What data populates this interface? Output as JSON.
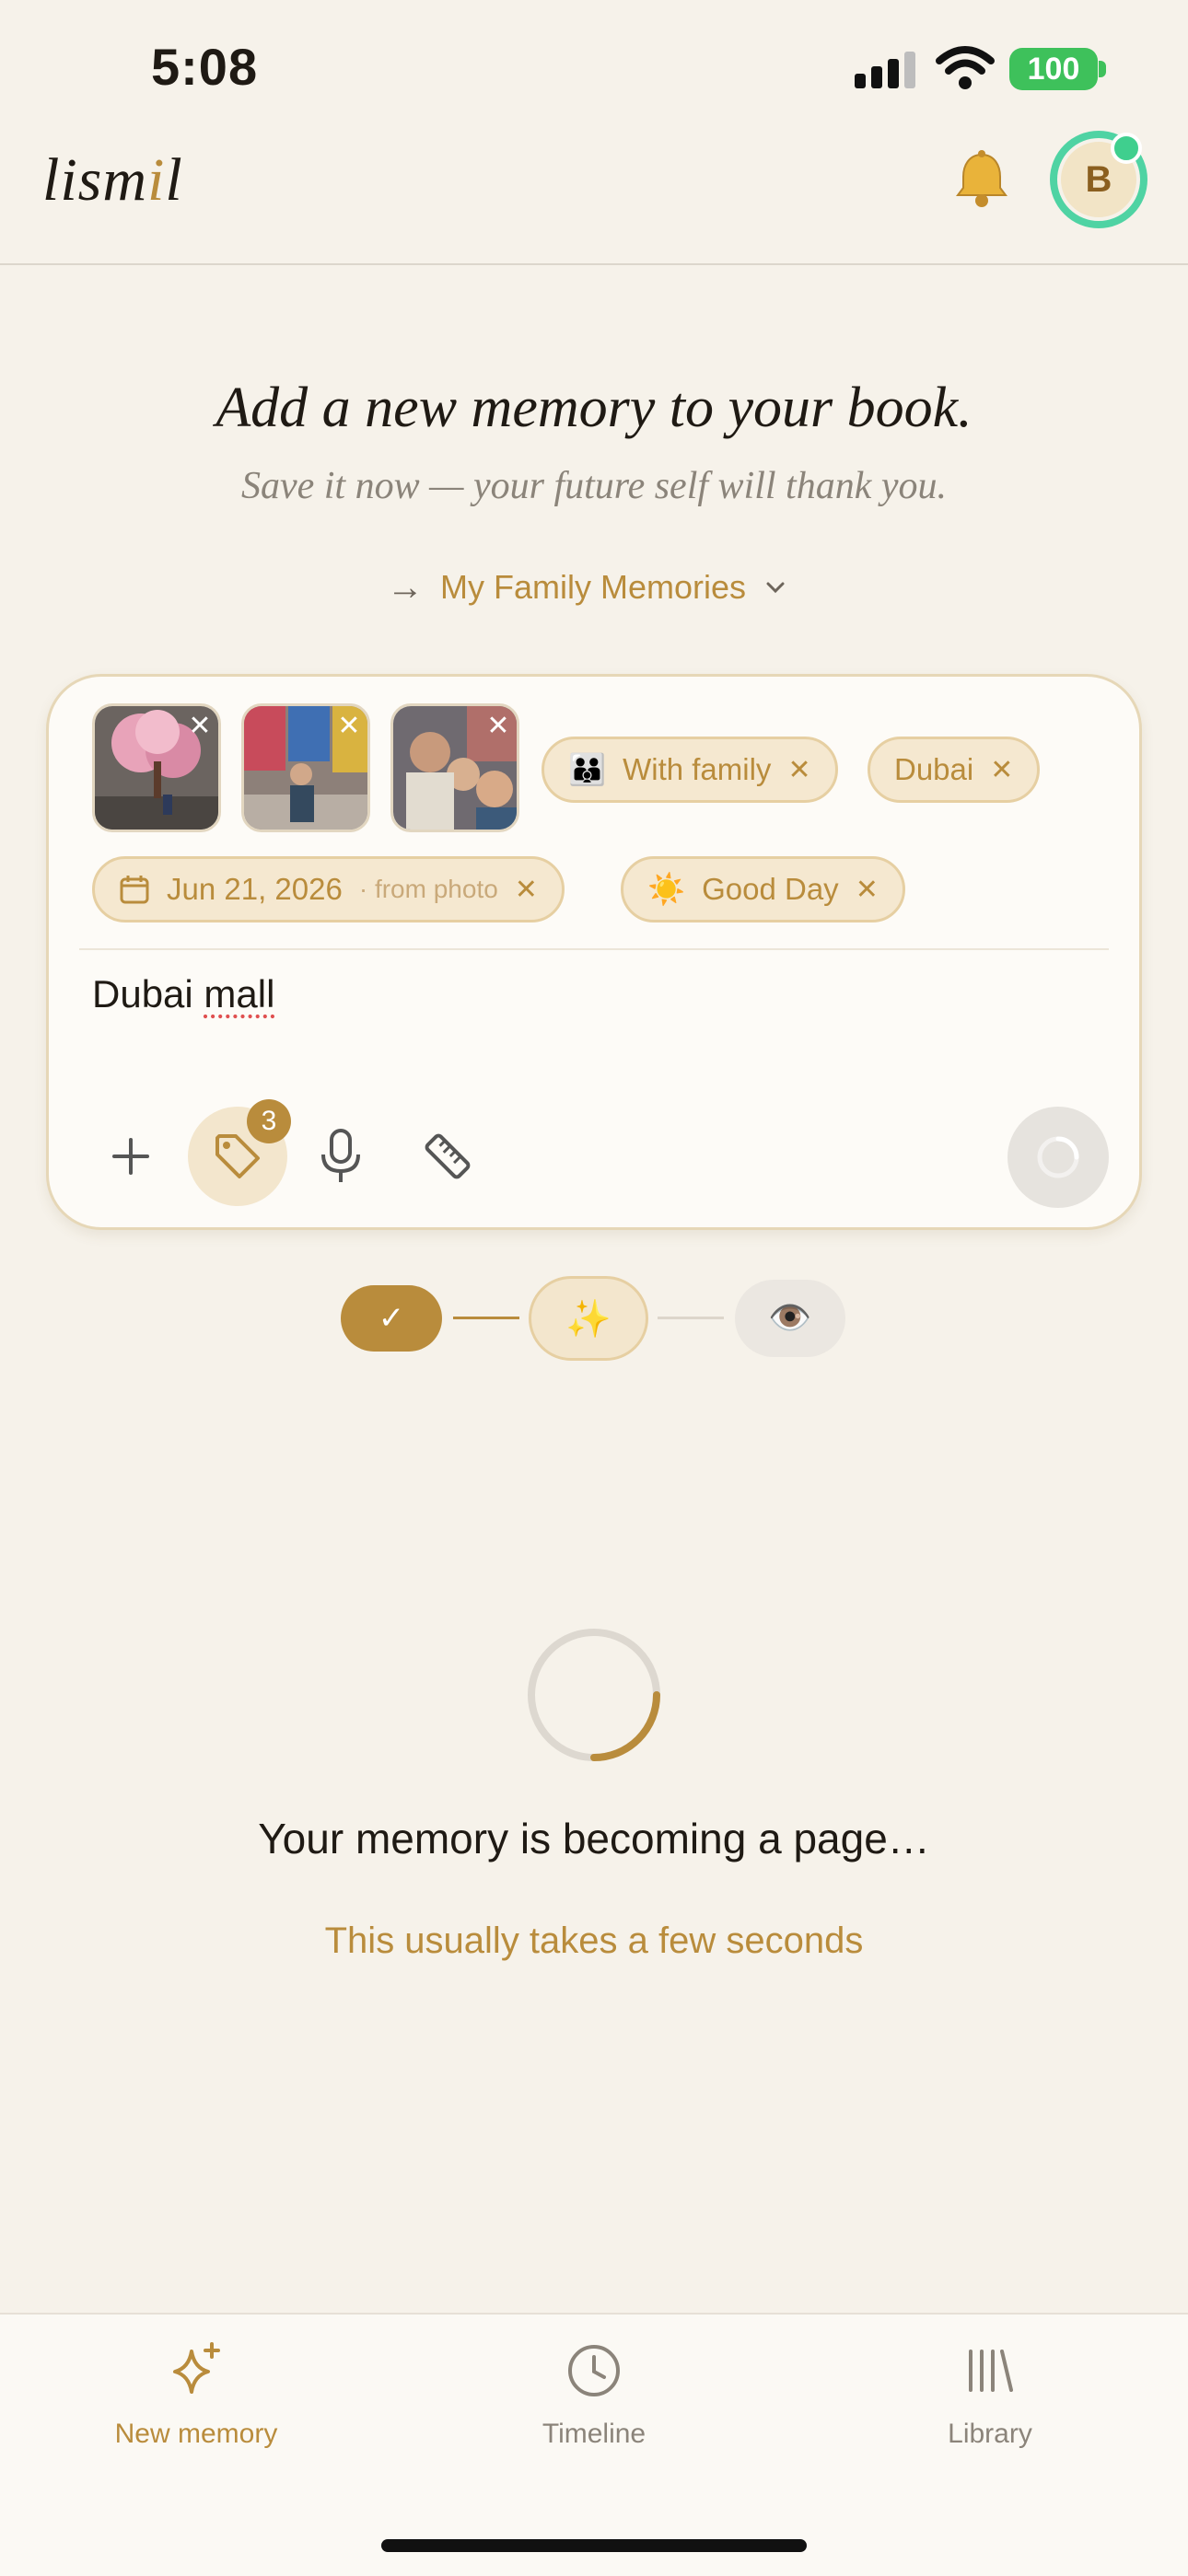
{
  "status_bar": {
    "time": "5:08",
    "battery": "100"
  },
  "header": {
    "logo_main": "lism",
    "logo_accent": "i",
    "logo_end": "l",
    "avatar_initial": "B"
  },
  "hero": {
    "title": "Add a new memory to your book.",
    "subtitle": "Save it now — your future self will thank you.",
    "book_arrow": "→",
    "book_name": "My Family Memories"
  },
  "composer": {
    "photos": [
      "cherry-blossom-photo",
      "mall-street-photo",
      "family-selfie-photo"
    ],
    "chips": {
      "family": {
        "emoji": "👪",
        "label": "With family"
      },
      "place": {
        "label": "Dubai"
      },
      "date": {
        "label": "Jun 21, 2026",
        "suffix": "· from photo"
      },
      "mood": {
        "emoji": "☀️",
        "label": "Good Day"
      }
    },
    "text_start": "Dubai ",
    "text_misspelled": "mall",
    "tag_count": "3"
  },
  "steps": {
    "done": "✓",
    "magic": "✨",
    "preview": "👁️"
  },
  "loading": {
    "title": "Your memory is becoming a page…",
    "subtitle": "This usually takes a few seconds"
  },
  "bottom_nav": [
    {
      "label": "New memory",
      "icon": "sparkle-icon",
      "active": true
    },
    {
      "label": "Timeline",
      "icon": "clock-icon",
      "active": false
    },
    {
      "label": "Library",
      "icon": "books-icon",
      "active": false
    }
  ],
  "colors": {
    "accent": "#b98c3c",
    "background": "#f6f2ea",
    "avatar_ring": "#4fd3a3",
    "battery": "#3ec15b"
  }
}
